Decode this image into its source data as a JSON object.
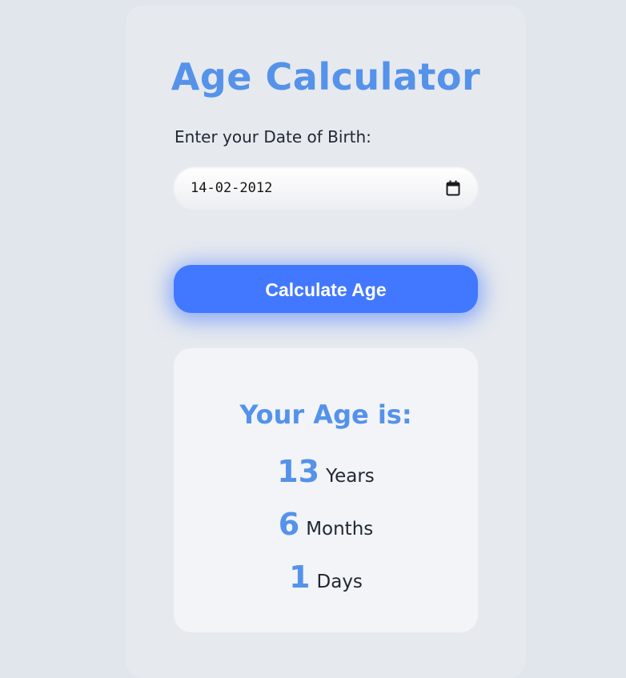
{
  "app": {
    "title": "Age Calculator"
  },
  "form": {
    "dob_label": "Enter your Date of Birth:",
    "dob_value": "14-02-2012",
    "calendar_icon": "calendar-icon",
    "calculate_label": "Calculate Age"
  },
  "result": {
    "heading": "Your Age is:",
    "years": {
      "value": "13",
      "unit": "Years"
    },
    "months": {
      "value": "6",
      "unit": "Months"
    },
    "days": {
      "value": "1",
      "unit": "Days"
    }
  },
  "colors": {
    "accent": "#5592ea",
    "button": "#4278ff",
    "background": "#e1e5ec",
    "card": "#e6e9ee",
    "panel": "#f2f4f7",
    "text": "#1f2733"
  }
}
